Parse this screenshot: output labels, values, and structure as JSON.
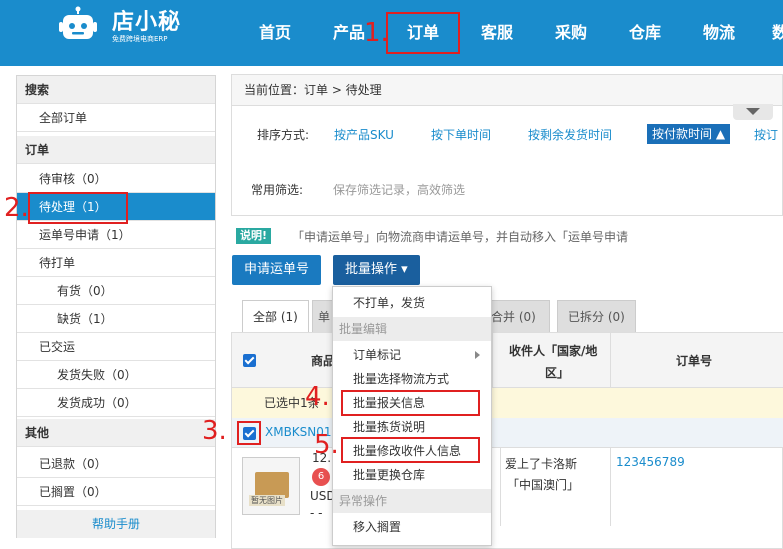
{
  "header": {
    "logo_text": "店小秘",
    "logo_subtitle": "免费跨境电商ERP",
    "nav": [
      "首页",
      "产品",
      "订单",
      "客服",
      "采购",
      "仓库",
      "物流",
      "数"
    ],
    "active_nav": "订单",
    "bg_color": "#1a8ccc"
  },
  "annotations": {
    "m1": "1.",
    "m2": "2.",
    "m3": "3.",
    "m4": "4.",
    "m5": "5."
  },
  "sidebar": {
    "search_header": "搜索",
    "all_orders": "全部订单",
    "order_header": "订单",
    "items": [
      {
        "label": "待审核",
        "count": "（0）"
      },
      {
        "label": "待处理",
        "count": "（1）"
      },
      {
        "label": "运单号申请",
        "count": "（1）"
      },
      {
        "label": "待打单",
        "count": ""
      },
      {
        "label": "有货",
        "count": "（0）"
      },
      {
        "label": "缺货",
        "count": "（1）"
      },
      {
        "label": "已交运",
        "count": ""
      },
      {
        "label": "发货失败",
        "count": "（0）"
      },
      {
        "label": "发货成功",
        "count": "（0）"
      }
    ],
    "other_header": "其他",
    "other_items": [
      {
        "label": "已退款",
        "count": "（0）"
      },
      {
        "label": "已搁置",
        "count": "（0）"
      }
    ],
    "help": "帮助手册"
  },
  "breadcrumb": "当前位置：订单 > 待处理",
  "sort": {
    "label": "排序方式:",
    "options": [
      "按产品SKU",
      "按下单时间",
      "按剩余发货时间",
      "按付款时间",
      "按订"
    ],
    "active": "按付款时间 ▲"
  },
  "filter": {
    "label": "常用筛选:",
    "placeholder": "保存筛选记录，高效筛选"
  },
  "note": {
    "badge": "说明!",
    "text": "「申请运单号」向物流商申请运单号，并自动移入「运单号申请"
  },
  "buttons": {
    "apply": "申请运单号",
    "batch": "批量操作 ▾"
  },
  "tabs": [
    "全部 (1)",
    "单",
    "合并 (0)",
    "已拆分 (0)"
  ],
  "table": {
    "col_product": "商品",
    "col_receiver_l1": "收件人「国家/地",
    "col_receiver_l2": "区」",
    "col_order": "订单号",
    "selected_text": "已选中1条",
    "order_sku": "XMBKSN01",
    "receiver_name": "爱上了卡洛斯",
    "receiver_country": "「中国澳门」",
    "order_number": "123456789",
    "qty": "6",
    "frag1": "12.",
    "frag2": "USD",
    "frag3": "- -",
    "img_label": "暂无图片"
  },
  "dropdown": {
    "items": [
      {
        "label": "不打单，发货",
        "type": "item"
      },
      {
        "label": "批量编辑",
        "type": "head"
      },
      {
        "label": "订单标记",
        "type": "item"
      },
      {
        "label": "批量选择物流方式",
        "type": "item"
      },
      {
        "label": "批量报关信息",
        "type": "item"
      },
      {
        "label": "批量拣货说明",
        "type": "item"
      },
      {
        "label": "批量修改收件人信息",
        "type": "item"
      },
      {
        "label": "批量更换仓库",
        "type": "item"
      },
      {
        "label": "异常操作",
        "type": "head"
      },
      {
        "label": "移入搁置",
        "type": "item"
      }
    ]
  }
}
